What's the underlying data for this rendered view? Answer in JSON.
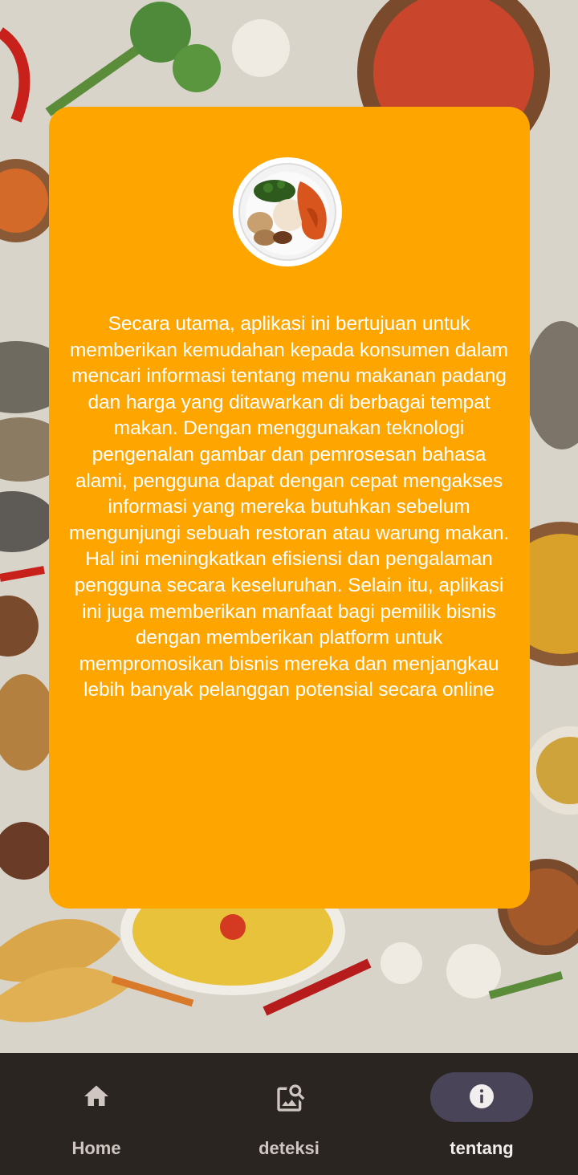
{
  "about": {
    "logo_icon": "nasi-padang-plate-icon",
    "description": "Secara utama, aplikasi ini bertujuan untuk memberikan kemudahan kepada konsumen dalam mencari informasi tentang menu makanan padang dan harga yang ditawarkan di berbagai tempat makan. Dengan menggunakan teknologi pengenalan gambar dan pemrosesan bahasa alami, pengguna dapat dengan cepat mengakses informasi yang mereka butuhkan sebelum mengunjungi sebuah restoran atau warung makan. Hal ini meningkatkan efisiensi dan pengalaman pengguna secara keseluruhan. Selain itu, aplikasi ini juga memberikan manfaat bagi pemilik bisnis dengan memberikan platform untuk mempromosikan bisnis mereka dan menjangkau lebih banyak pelanggan potensial secara online"
  },
  "colors": {
    "card": "#FFA500",
    "nav_bg": "#2b2522",
    "active_pill": "#4a4458"
  },
  "nav": {
    "items": [
      {
        "label": "Home",
        "icon": "home-icon",
        "active": false
      },
      {
        "label": "deteksi",
        "icon": "image-search-icon",
        "active": false
      },
      {
        "label": "tentang",
        "icon": "info-icon",
        "active": true
      }
    ]
  }
}
